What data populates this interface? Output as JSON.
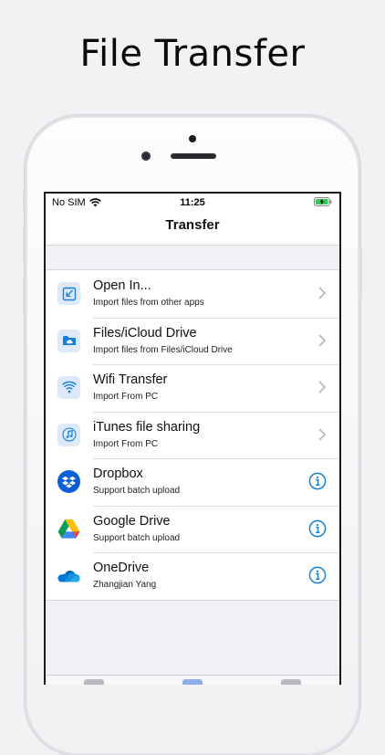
{
  "headline": "File Transfer",
  "status": {
    "carrier": "No SIM",
    "time": "11:25"
  },
  "nav": {
    "title": "Transfer"
  },
  "items": [
    {
      "title": "Open In...",
      "subtitle": "Import files from other apps",
      "icon": "import-icon",
      "accessory": "chevron"
    },
    {
      "title": "Files/iCloud Drive",
      "subtitle": "Import files from Files/iCloud Drive",
      "icon": "folder-icon",
      "accessory": "chevron"
    },
    {
      "title": "Wifi Transfer",
      "subtitle": "Import From PC",
      "icon": "wifi-icon",
      "accessory": "chevron"
    },
    {
      "title": "iTunes file sharing",
      "subtitle": "Import From PC",
      "icon": "music-note-icon",
      "accessory": "chevron"
    },
    {
      "title": "Dropbox",
      "subtitle": "Support batch upload",
      "icon": "dropbox-icon",
      "accessory": "info"
    },
    {
      "title": "Google Drive",
      "subtitle": "Support batch upload",
      "icon": "google-drive-icon",
      "accessory": "info"
    },
    {
      "title": "OneDrive",
      "subtitle": "Zhangjian Yang",
      "icon": "onedrive-icon",
      "accessory": "info"
    }
  ],
  "colors": {
    "accent": "#1a7fd4",
    "tile": "#dde8f8",
    "chevron": "#b8b8bd",
    "battery": "#35c759"
  }
}
